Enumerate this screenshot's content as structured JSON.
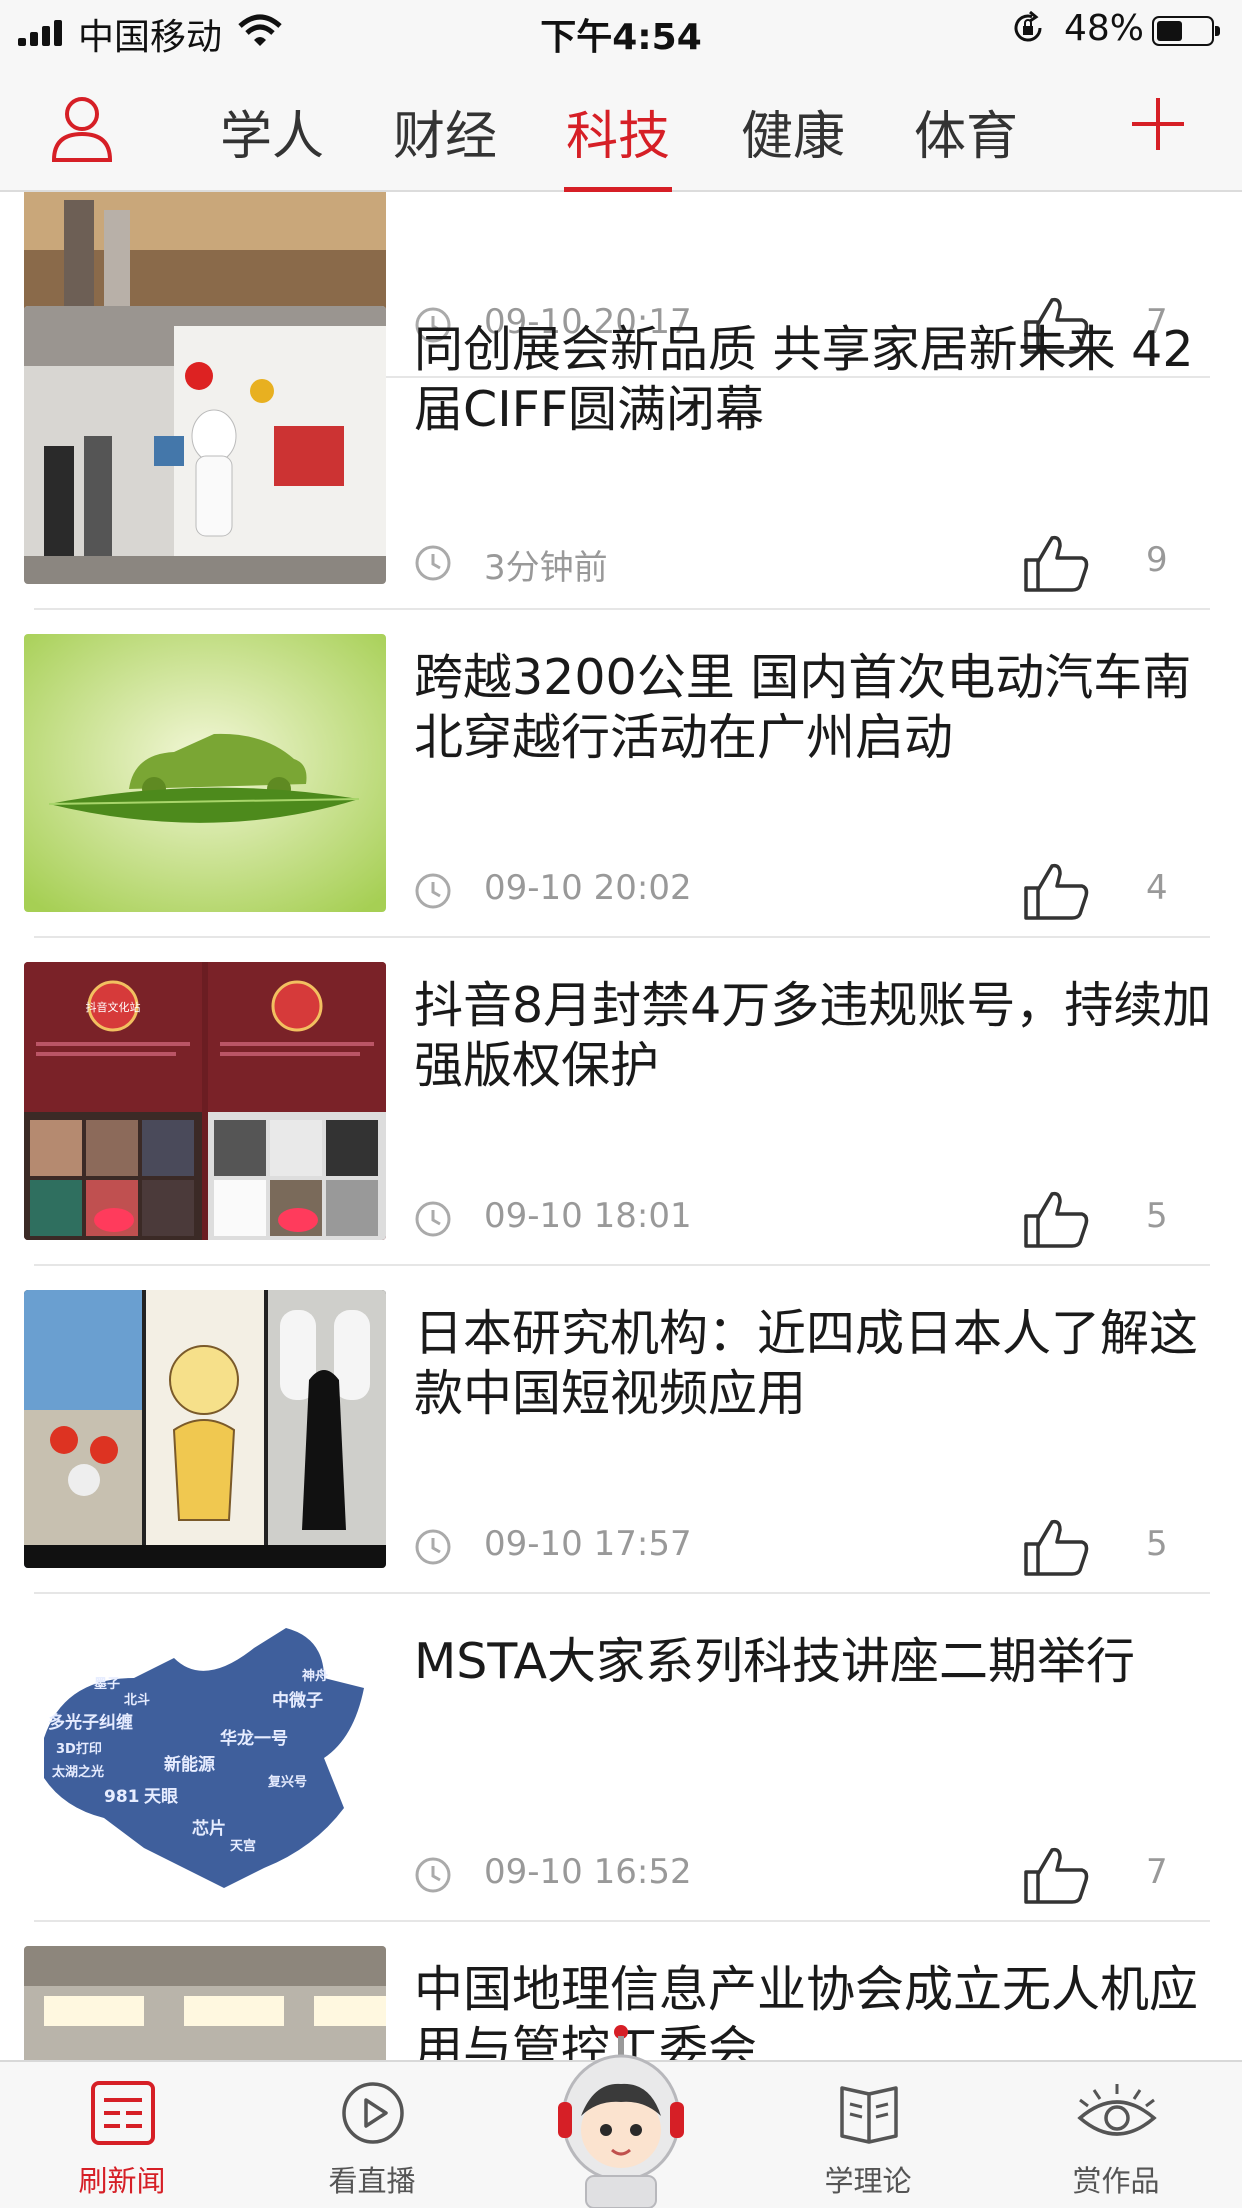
{
  "status_bar": {
    "carrier": "中国移动",
    "time": "下午4:54",
    "battery": "48%",
    "battery_level": 0.48,
    "icons": [
      "signal-icon",
      "wifi-icon",
      "orientation-lock-icon",
      "battery-icon"
    ]
  },
  "top_nav": {
    "user_icon": "user-icon",
    "add_icon": "plus-icon",
    "tabs": [
      {
        "label": "学人"
      },
      {
        "label": "财经"
      },
      {
        "label": "科技",
        "active": true
      },
      {
        "label": "健康"
      },
      {
        "label": "体育"
      }
    ]
  },
  "feed": {
    "items": [
      {
        "title": "",
        "time": "09-10 20:17",
        "likes": "7"
      },
      {
        "title": "同创展会新品质 共享家居新未来 42届CIFF圆满闭幕",
        "time": "3分钟前",
        "likes": "9"
      },
      {
        "title": "跨越3200公里 国内首次电动汽车南北穿越行活动在广州启动",
        "time": "09-10 20:02",
        "likes": "4"
      },
      {
        "title": "抖音8月封禁4万多违规账号，持续加强版权保护",
        "time": "09-10 18:01",
        "likes": "5"
      },
      {
        "title": "日本研究机构：近四成日本人了解这款中国短视频应用",
        "time": "09-10 17:57",
        "likes": "5"
      },
      {
        "title": "MSTA大家系列科技讲座二期举行",
        "time": "09-10 16:52",
        "likes": "7"
      },
      {
        "title": "中国地理信息产业协会成立无人机应用与管控工委会",
        "time": "",
        "likes": ""
      }
    ],
    "thumb_text": {
      "douyin_badge": "抖音文化站",
      "map_words": [
        "多光子纠缠",
        "3D打印",
        "太湖之光",
        "981",
        "天眼",
        "新能源",
        "芯片",
        "天宫",
        "中微子",
        "神舟",
        "复兴号",
        "华龙一号",
        "墨子",
        "北斗"
      ]
    },
    "icons": {
      "time": "clock-icon",
      "like": "thumbs-up-icon"
    }
  },
  "bottom_nav": {
    "items": [
      {
        "label": "刷新闻",
        "icon": "news-icon",
        "active": true
      },
      {
        "label": "看直播",
        "icon": "play-icon"
      },
      {
        "label": "学理论",
        "icon": "book-icon"
      },
      {
        "label": "赏作品",
        "icon": "eye-icon"
      }
    ],
    "mascot": "robot-mascot-icon"
  },
  "colors": {
    "accent": "#d61f26",
    "meta_text": "#999999",
    "divider": "#e6e6e6"
  }
}
